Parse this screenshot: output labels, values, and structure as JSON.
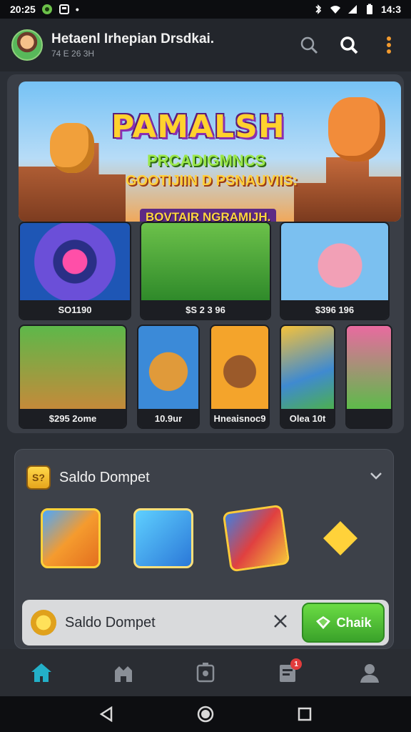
{
  "status_bar": {
    "time": "20:25",
    "clock": "14:3"
  },
  "header": {
    "title": "Hetaenl Irhepian Drsdkai.",
    "subtitle": "74 E 26 3H"
  },
  "banner": {
    "title": "PAMALSH",
    "subtitle": "PRCADIGMNCS",
    "tagline": "GOOTIJIIN D PSNAUVIIS:",
    "ribbon": "BOVTAIR NGRAMIJH."
  },
  "games_row1": [
    {
      "label": "SO1190"
    },
    {
      "label": "$S 2 3 96"
    },
    {
      "label": "$396 196"
    }
  ],
  "games_row2": [
    {
      "label": "$295 2ome"
    },
    {
      "label": "10.9ur"
    },
    {
      "label": "Hneaisnoc9"
    },
    {
      "label": "Olea 10t"
    },
    {
      "label": ""
    }
  ],
  "wallet": {
    "icon_text": "S?",
    "title": "Saldo Dompet",
    "bar_title": "Saldo Dompet",
    "claim_label": "Chaik"
  },
  "bottom_nav": {
    "badge": "1"
  },
  "colors": {
    "accent": "#23b0c8",
    "claim_green": "#4cbf31",
    "gold": "#ffd23a"
  }
}
